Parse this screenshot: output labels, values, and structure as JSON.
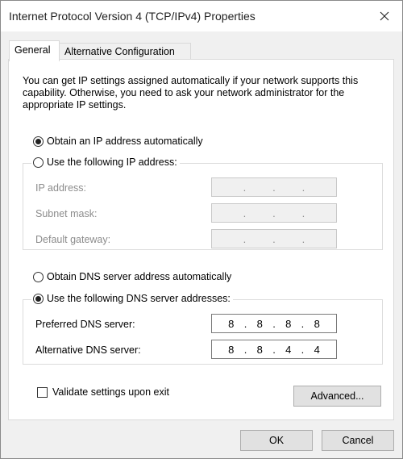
{
  "window": {
    "title": "Internet Protocol Version 4 (TCP/IPv4) Properties"
  },
  "tabs": [
    {
      "label": "General"
    },
    {
      "label": "Alternative Configuration"
    }
  ],
  "general": {
    "description": "You can get IP settings assigned automatically if your network supports this capability. Otherwise, you need to ask your network administrator for the appropriate IP settings.",
    "ip_auto_label": "Obtain an IP address automatically",
    "ip_manual_label": "Use the following IP address:",
    "ip_mode": "auto",
    "ip_address": {
      "label": "IP address:",
      "octets": [
        "",
        "",
        "",
        ""
      ]
    },
    "subnet_mask": {
      "label": "Subnet mask:",
      "octets": [
        "",
        "",
        "",
        ""
      ]
    },
    "default_gateway": {
      "label": "Default gateway:",
      "octets": [
        "",
        "",
        "",
        ""
      ]
    },
    "dns_auto_label": "Obtain DNS server address automatically",
    "dns_manual_label": "Use the following DNS server addresses:",
    "dns_mode": "manual",
    "preferred_dns": {
      "label": "Preferred DNS server:",
      "octets": [
        "8",
        "8",
        "8",
        "8"
      ]
    },
    "alternative_dns": {
      "label": "Alternative DNS server:",
      "octets": [
        "8",
        "8",
        "4",
        "4"
      ]
    },
    "validate_label": "Validate settings upon exit",
    "validate_checked": false,
    "advanced_label": "Advanced..."
  },
  "footer": {
    "ok_label": "OK",
    "cancel_label": "Cancel"
  },
  "icons": {
    "close": "close-icon"
  }
}
